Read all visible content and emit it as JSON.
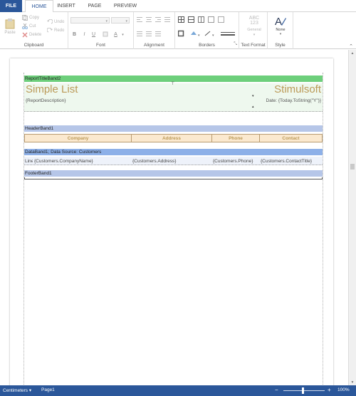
{
  "menu": {
    "file": "FILE",
    "tabs": [
      "HOME",
      "INSERT",
      "PAGE",
      "PREVIEW"
    ],
    "active_tab": "HOME"
  },
  "ribbon": {
    "clipboard": {
      "label": "Clipboard",
      "paste": "Paste",
      "copy": "Copy",
      "cut": "Cut",
      "delete": "Delete"
    },
    "undo": {
      "undo": "Undo",
      "redo": "Redo"
    },
    "font": {
      "label": "Font",
      "bold": "B",
      "italic": "I",
      "underline": "U",
      "color": "A"
    },
    "alignment": {
      "label": "Alignment"
    },
    "borders": {
      "label": "Borders"
    },
    "text_format": {
      "label": "Text Format",
      "abc": "ABC",
      "num": "123",
      "general": "General"
    },
    "style": {
      "label": "Style",
      "none": "None"
    }
  },
  "report": {
    "report_title_band": "ReportTitleBand2",
    "title_left": "Simple List",
    "title_right": "Stimulsoft",
    "description": "{ReportDescription}",
    "date_expr": "Date: {Today.ToString(\"Y\")}",
    "header_band": "HeaderBand1",
    "headers": [
      "Company",
      "Address",
      "Phone",
      "Contact"
    ],
    "data_band": "DataBand1; Data Source: Customers",
    "data_cells": [
      "Line",
      "{Customers.CompanyName}",
      "{Customers.Address}",
      "{Customers.Phone}",
      "{Customers.ContactTitle}"
    ],
    "footer_band": "FooterBand1"
  },
  "status": {
    "units": "Centimeters ▾",
    "page": "Page1",
    "zoom_minus": "−",
    "zoom_plus": "+",
    "zoom": "100%"
  },
  "colors": {
    "accent": "#2b579a",
    "title_band": "#6dcf7b",
    "header_band": "#b6c6e8",
    "data_band": "#8db0e8",
    "text_gold": "#bb9a58"
  }
}
